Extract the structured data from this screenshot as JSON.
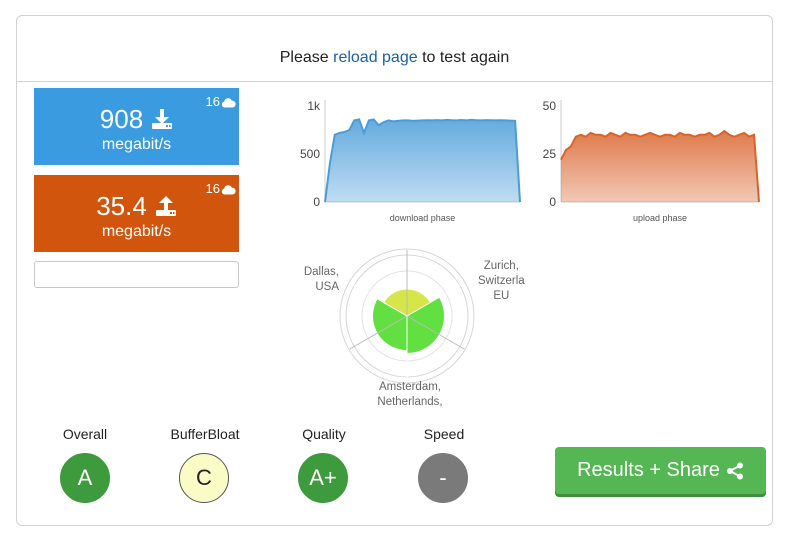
{
  "header": {
    "prefix": "Please ",
    "link": "reload page",
    "suffix": " to test again"
  },
  "download": {
    "value": "908",
    "unit": "megabit/s",
    "count": "16",
    "color": "#3a9be0"
  },
  "upload": {
    "value": "35.4",
    "unit": "megabit/s",
    "count": "16",
    "color": "#d2550d"
  },
  "chart_data": [
    {
      "type": "area",
      "xlabel": "download phase",
      "ylabel": "",
      "y_ticks": [
        "1k",
        "500",
        "0"
      ],
      "ylim": [
        0,
        1000
      ],
      "x": [
        0,
        1,
        2,
        3,
        4,
        5,
        6,
        7,
        8,
        9,
        10,
        11,
        12,
        13,
        14,
        15,
        16,
        17,
        18,
        19,
        20,
        21,
        22,
        23,
        24,
        25,
        26,
        27,
        28,
        29,
        30,
        31,
        32,
        33,
        34,
        35,
        36,
        37,
        38,
        39,
        40
      ],
      "values": [
        0,
        400,
        700,
        720,
        730,
        750,
        850,
        860,
        720,
        850,
        860,
        800,
        830,
        850,
        840,
        845,
        850,
        850,
        845,
        848,
        850,
        852,
        850,
        853,
        850,
        855,
        852,
        850,
        854,
        850,
        855,
        852,
        850,
        853,
        851,
        850,
        852,
        850,
        848,
        845,
        0
      ],
      "color": "#4a9cd8"
    },
    {
      "type": "area",
      "xlabel": "upload phase",
      "ylabel": "",
      "y_ticks": [
        "50",
        "25",
        "0"
      ],
      "ylim": [
        0,
        50
      ],
      "x": [
        0,
        1,
        2,
        3,
        4,
        5,
        6,
        7,
        8,
        9,
        10,
        11,
        12,
        13,
        14,
        15,
        16,
        17,
        18,
        19,
        20,
        21,
        22,
        23,
        24,
        25,
        26,
        27,
        28,
        29,
        30,
        31,
        32,
        33,
        34,
        35,
        36,
        37,
        38,
        39,
        40
      ],
      "values": [
        22,
        27,
        29,
        34,
        35,
        34,
        36,
        35,
        35,
        34,
        36,
        35,
        34,
        36,
        35,
        35,
        34,
        35,
        36,
        35,
        34,
        35,
        35,
        34,
        36,
        35,
        35,
        34,
        35,
        35,
        36,
        34,
        35,
        37,
        35,
        34,
        35,
        36,
        34,
        35,
        0
      ],
      "color": "#d9632c"
    },
    {
      "type": "radar",
      "labels": [
        {
          "line1": "Dallas,",
          "line2": "USA"
        },
        {
          "line1": "Zurich,",
          "line2": "Switzerla",
          "line3": "EU"
        },
        {
          "line1": "Amsterdam,",
          "line2": "Netherlands,"
        }
      ],
      "segments": [
        {
          "name": "Dallas",
          "value": 0.55,
          "color": "#d6e64a"
        },
        {
          "name": "Zurich",
          "value": 0.9,
          "color": "#62e041"
        },
        {
          "name": "Amsterdam",
          "value": 0.8,
          "color": "#62e041"
        }
      ]
    }
  ],
  "grades": [
    {
      "label": "Overall",
      "value": "A",
      "bg": "#3d9a3d",
      "fg": "#ffffff",
      "border": "#3d9a3d"
    },
    {
      "label": "BufferBloat",
      "value": "C",
      "bg": "#fafcc6",
      "fg": "#222222",
      "border": "#555555"
    },
    {
      "label": "Quality",
      "value": "A+",
      "bg": "#3d9a3d",
      "fg": "#ffffff",
      "border": "#3d9a3d"
    },
    {
      "label": "Speed",
      "value": "-",
      "bg": "#7a7a7a",
      "fg": "#ffffff",
      "border": "#7a7a7a"
    }
  ],
  "share": {
    "label": "Results + Share",
    "icon": "share-icon"
  }
}
